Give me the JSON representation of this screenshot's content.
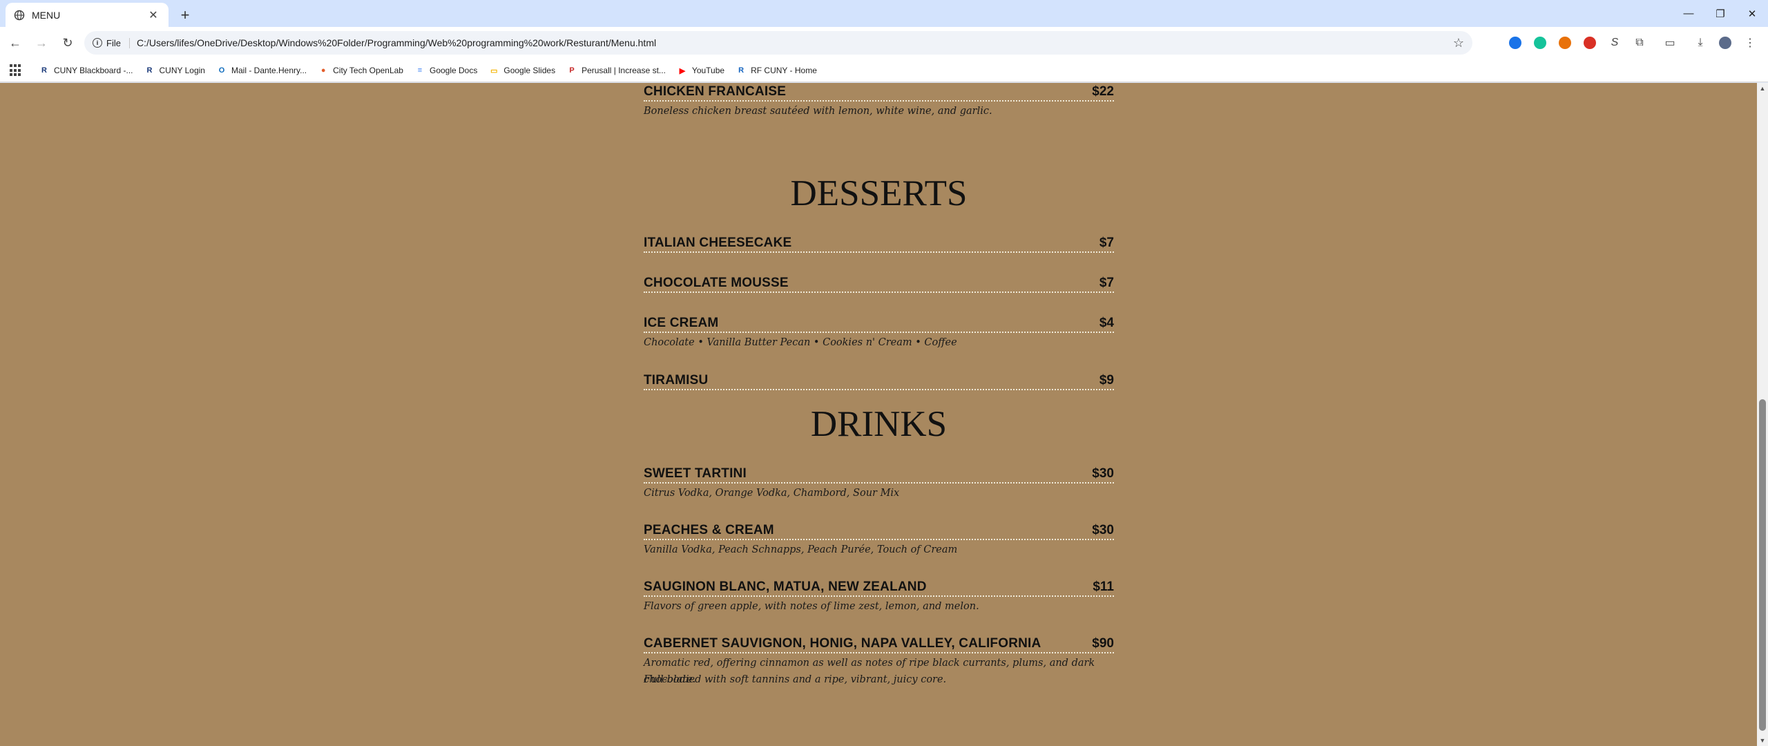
{
  "browser": {
    "tab_title": "MENU",
    "address": {
      "chip_label": "File",
      "url": "C:/Users/lifes/OneDrive/Desktop/Windows%20Folder/Programming/Web%20programming%20work/Resturant/Menu.html"
    },
    "bookmarks": [
      {
        "label": "CUNY Blackboard -...",
        "icon": "blackboard-icon",
        "color": "#1b3a7a"
      },
      {
        "label": "CUNY Login",
        "icon": "cuny-icon",
        "color": "#1b3a7a"
      },
      {
        "label": "Mail - Dante.Henry...",
        "icon": "outlook-icon",
        "color": "#0f6cbd"
      },
      {
        "label": "City Tech OpenLab",
        "icon": "openlab-icon",
        "color": "#e35d2b"
      },
      {
        "label": "Google Docs",
        "icon": "docs-icon",
        "color": "#4285f4"
      },
      {
        "label": "Google Slides",
        "icon": "slides-icon",
        "color": "#f4b400"
      },
      {
        "label": "Perusall | Increase st...",
        "icon": "perusall-icon",
        "color": "#c62828"
      },
      {
        "label": "YouTube",
        "icon": "youtube-icon",
        "color": "#ff0000"
      },
      {
        "label": "RF CUNY - Home",
        "icon": "rfcuny-icon",
        "color": "#1565c0"
      }
    ]
  },
  "menu": {
    "top_item": {
      "name": "CHICKEN FRANCAISE",
      "price": "$22",
      "desc": "Boneless chicken breast sautéed with lemon, white wine, and garlic."
    },
    "desserts": {
      "title": "DESSERTS",
      "items": [
        {
          "name": "ITALIAN CHEESECAKE",
          "price": "$7"
        },
        {
          "name": "CHOCOLATE MOUSSE",
          "price": "$7"
        },
        {
          "name": "ICE CREAM",
          "price": "$4",
          "desc": "Chocolate • Vanilla Butter Pecan • Cookies n' Cream • Coffee"
        },
        {
          "name": "TIRAMISU",
          "price": "$9"
        }
      ]
    },
    "drinks": {
      "title": "DRINKS",
      "items": [
        {
          "name": "SWEET TARTINI",
          "price": "$30",
          "desc": "Citrus Vodka, Orange Vodka, Chambord, Sour Mix"
        },
        {
          "name": "PEACHES & CREAM",
          "price": "$30",
          "desc": "Vanilla Vodka, Peach Schnapps, Peach Purée, Touch of Cream"
        },
        {
          "name": "SAUGINON BLANC, MATUA, NEW ZEALAND",
          "price": "$11",
          "desc": "Flavors of green apple, with notes of lime zest, lemon, and melon."
        },
        {
          "name": "CABERNET SAUVIGNON, HONIG, NAPA VALLEY, CALIFORNIA",
          "price": "$90",
          "desc": "Aromatic red, offering cinnamon as well as notes of ripe black currants, plums, and dark chocolate.",
          "desc2": "Full-bodied with soft tannins and a ripe, vibrant, juicy core."
        }
      ]
    }
  },
  "colors": {
    "page_background": "#a8885f",
    "tabstrip": "#d3e3fd",
    "text": "#111111"
  }
}
